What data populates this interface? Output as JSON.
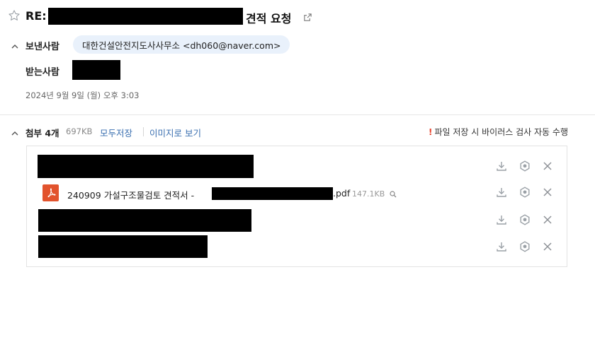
{
  "header": {
    "title_prefix": "RE:",
    "title_suffix": "견적 요청"
  },
  "sender": {
    "label": "보낸사람",
    "chip": "대한건설안전지도사사무소 <dh060@naver.com>"
  },
  "recipient": {
    "label": "받는사람"
  },
  "date": "2024년 9월 9일 (월) 오후 3:03",
  "attachments": {
    "label": "첨부 4개",
    "total_size": "697KB",
    "save_all": "모두저장",
    "view_images": "이미지로 보기",
    "virus_note": "파일 저장 시 바이러스 검사 자동 수행",
    "virus_mark": "!",
    "files": [
      {
        "name": "240909 가설구조물검토 견적서 -",
        "ext": ".pdf",
        "size": "147.1KB"
      }
    ]
  },
  "colors": {
    "accent": "#3a6fb0",
    "chip_bg": "#e9f1fb",
    "warning": "#e8442e",
    "pdf": "#e2532d"
  },
  "icons": [
    "star-icon",
    "external-link-icon",
    "chevron-up-icon",
    "pdf-file-icon",
    "download-icon",
    "vaccine-icon",
    "close-icon",
    "magnifier-icon"
  ]
}
